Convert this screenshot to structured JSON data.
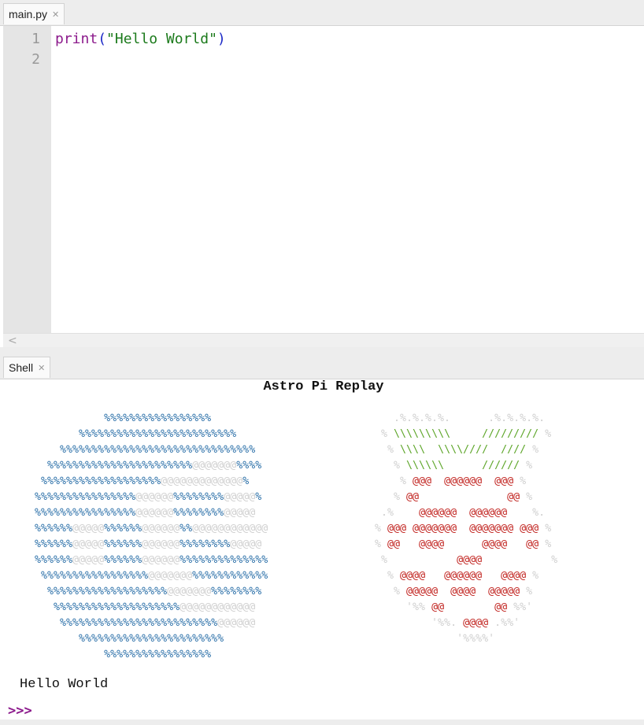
{
  "editor": {
    "tab_label": "main.py",
    "lines": [
      "1",
      "2"
    ],
    "code": {
      "func": "print",
      "open": "(",
      "string": "\"Hello World\"",
      "close": ")"
    }
  },
  "shell": {
    "tab_label": "Shell",
    "replay_title": "Astro Pi Replay",
    "output": "Hello World",
    "prompt": ">>>"
  },
  "icons": {
    "close": "close-icon",
    "scroll_left": "chevron-left-icon"
  }
}
